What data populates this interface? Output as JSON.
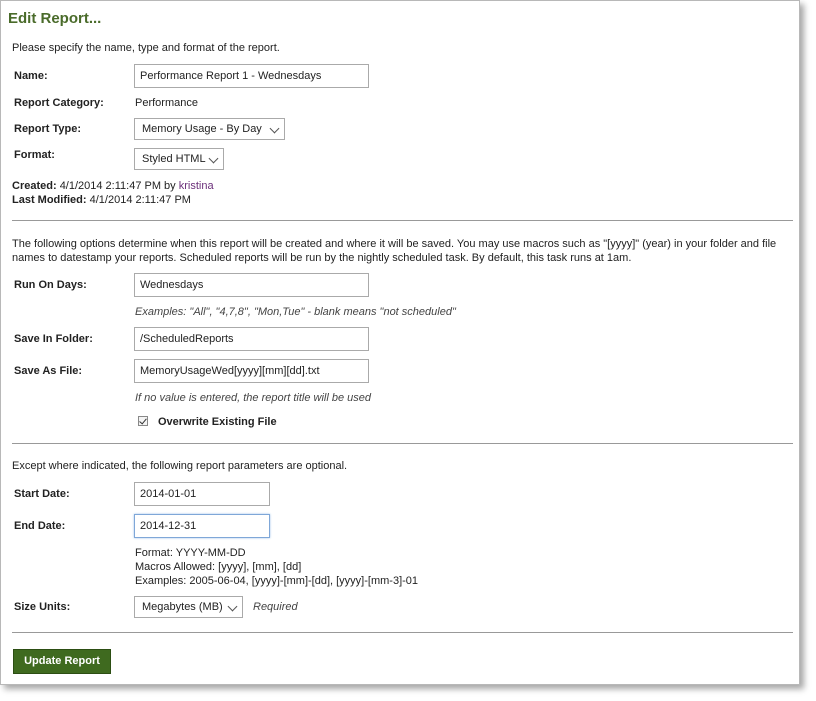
{
  "title": "Edit Report...",
  "intro": "Please specify the name, type and format of the report.",
  "fields": {
    "name": {
      "label": "Name:",
      "value": "Performance Report 1 - Wednesdays"
    },
    "category": {
      "label": "Report Category:",
      "value": "Performance"
    },
    "type": {
      "label": "Report Type:",
      "value": "Memory Usage - By Day"
    },
    "format": {
      "label": "Format:",
      "value": "Styled HTML"
    }
  },
  "meta": {
    "created_label": "Created:",
    "created_value": "4/1/2014 2:11:47 PM by",
    "created_by": "kristina",
    "modified_label": "Last Modified:",
    "modified_value": "4/1/2014 2:11:47 PM"
  },
  "schedule": {
    "intro_line1": "The following options determine when this report will be created and where it will be saved. You may use macros such as \"[yyyy]\" (year) in your folder and file",
    "intro_line2": "names to datestamp your reports. Scheduled reports will be run by the nightly scheduled task. By default, this task runs at 1am.",
    "run_label": "Run On Days:",
    "run_value": "Wednesdays",
    "run_hint": "Examples: \"All\", \"4,7,8\", \"Mon,Tue\" - blank means \"not scheduled\"",
    "folder_label": "Save In Folder:",
    "folder_value": "/ScheduledReports",
    "file_label": "Save As File:",
    "file_value": "MemoryUsageWed[yyyy][mm][dd].txt",
    "file_hint": "If no value is entered, the report title will be used",
    "overwrite_label": "Overwrite Existing File",
    "overwrite_checked": true
  },
  "params": {
    "intro": "Except where indicated, the following report parameters are optional.",
    "start_label": "Start Date:",
    "start_value": "2014-01-01",
    "end_label": "End Date:",
    "end_value": "2014-12-31",
    "hint_format": "Format: YYYY-MM-DD",
    "hint_macros": "Macros Allowed: [yyyy], [mm], [dd]",
    "hint_examples": "Examples: 2005-06-04, [yyyy]-[mm]-[dd], [yyyy]-[mm-3]-01",
    "units_label": "Size Units:",
    "units_value": "Megabytes (MB)",
    "units_required": "Required"
  },
  "submit_label": "Update Report",
  "colors": {
    "title": "#4a6b2a",
    "button": "#3f6a1f",
    "link": "#6b2f7a"
  }
}
